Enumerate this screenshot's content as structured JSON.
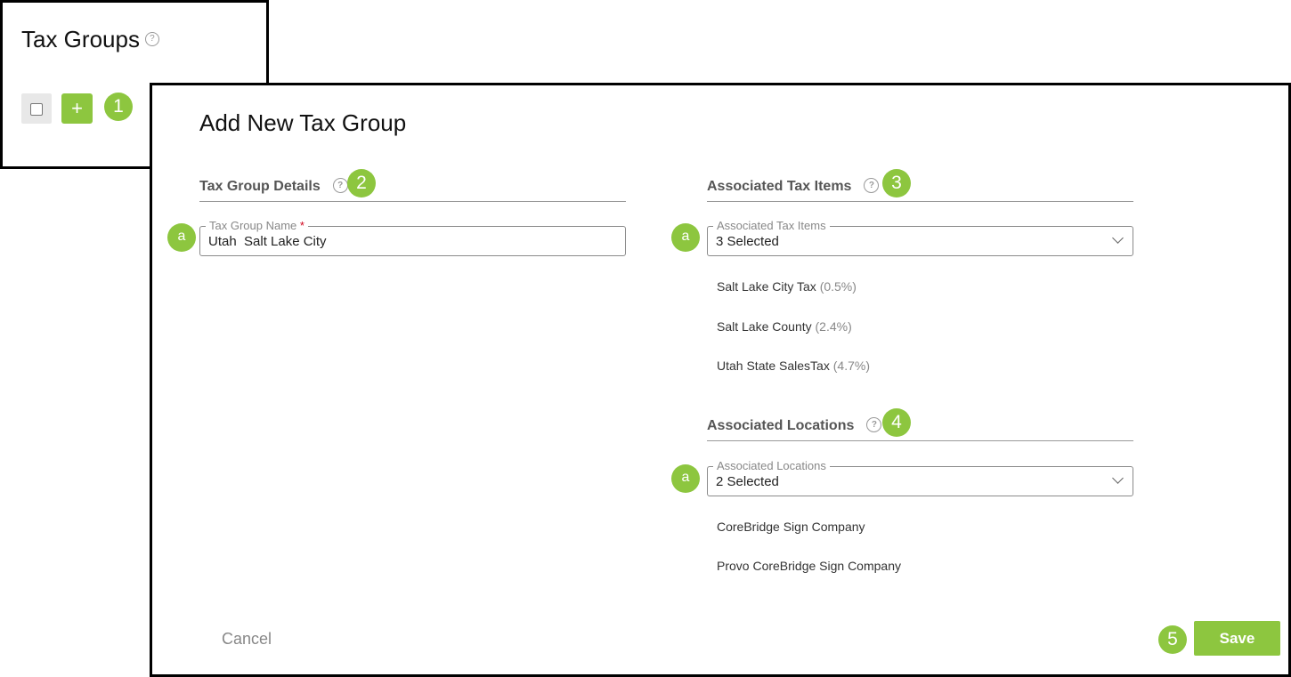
{
  "background_page": {
    "title": "Tax Groups",
    "help_glyph": "?",
    "add_glyph": "+",
    "callout": "1"
  },
  "dialog": {
    "title": "Add New Tax Group",
    "details_section": {
      "heading": "Tax Group Details",
      "callout": "2",
      "name_field": {
        "label": "Tax Group Name",
        "required_mark": "*",
        "value": "Utah  Salt Lake City",
        "callout": "a"
      }
    },
    "tax_items_section": {
      "heading": "Associated Tax Items",
      "callout": "3",
      "select": {
        "label": "Associated Tax Items",
        "value": "3 Selected",
        "callout": "a"
      },
      "items": [
        {
          "name": "Salt Lake City Tax",
          "rate": "(0.5%)"
        },
        {
          "name": "Salt Lake County",
          "rate": "(2.4%)"
        },
        {
          "name": "Utah State SalesTax",
          "rate": "(4.7%)"
        }
      ]
    },
    "locations_section": {
      "heading": "Associated Locations",
      "callout": "4",
      "select": {
        "label": "Associated Locations",
        "value": "2 Selected",
        "callout": "a"
      },
      "items": [
        {
          "name": "CoreBridge Sign Company"
        },
        {
          "name": "Provo CoreBridge Sign Company"
        }
      ]
    },
    "footer": {
      "cancel_label": "Cancel",
      "save_label": "Save",
      "callout": "5"
    }
  },
  "colors": {
    "accent_green": "#8dc63f",
    "required_red": "#d0021b"
  }
}
